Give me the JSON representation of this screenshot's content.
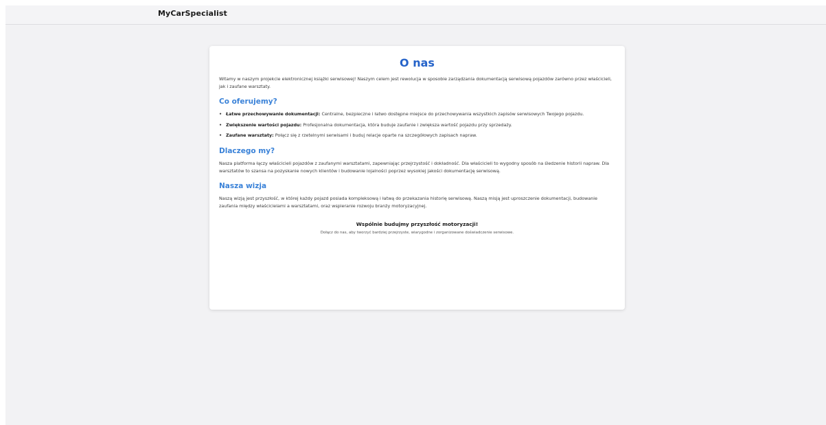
{
  "app": {
    "brand": "MyCarSpecialist"
  },
  "about": {
    "title": "O nas",
    "intro": "Witamy w naszym projekcie elektronicznej książki serwisowej! Naszym celem jest rewolucja w sposobie zarządzania dokumentacją serwisową pojazdów zarówno przez właścicieli, jak i zaufane warsztaty.",
    "offer": {
      "heading": "Co oferujemy?",
      "items": [
        {
          "bold": "Łatwe przechowywanie dokumentacji:",
          "text": "Centralne, bezpieczne i łatwo dostępne miejsce do przechowywania wszystkich zapisów serwisowych Twojego pojazdu."
        },
        {
          "bold": "Zwiększenie wartości pojazdu:",
          "text": "Profesjonalna dokumentacja, która buduje zaufanie i zwiększa wartość pojazdu przy sprzedaży."
        },
        {
          "bold": "Zaufane warsztaty:",
          "text": "Połącz się z rzetelnymi serwisami i buduj relacje oparte na szczegółowych zapisach napraw."
        }
      ]
    },
    "why": {
      "heading": "Dlaczego my?",
      "text": "Nasza platforma łączy właścicieli pojazdów z zaufanymi warsztatami, zapewniając przejrzystość i dokładność. Dla właścicieli to wygodny sposób na śledzenie historii napraw. Dla warsztatów to szansa na pozyskanie nowych klientów i budowanie lojalności poprzez wysokiej jakości dokumentację serwisową."
    },
    "vision": {
      "heading": "Nasza wizja",
      "text": "Naszą wizją jest przyszłość, w której każdy pojazd posiada kompleksową i łatwą do przekazania historię serwisową. Naszą misją jest uproszczenie dokumentacji, budowanie zaufania między właścicielami a warsztatami, oraz wspieranie rozwoju branży motoryzacyjnej."
    },
    "closing": {
      "title": "Wspólnie budujmy przyszłość motoryzacji!",
      "subtitle": "Dołącz do nas, aby tworzyć bardziej przejrzyste, wiarygodne i zorganizowane doświadczenie serwisowe."
    }
  },
  "colors": {
    "title": "#2563c9",
    "section_heading": "#3a82d8",
    "background": "#f2f2f4",
    "card": "#ffffff"
  }
}
